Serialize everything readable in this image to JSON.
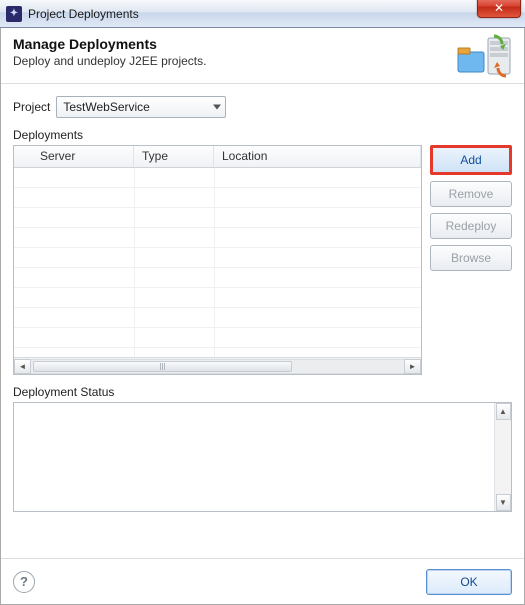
{
  "window": {
    "title": "Project Deployments",
    "close_glyph": "✕"
  },
  "header": {
    "title": "Manage Deployments",
    "subtitle": "Deploy and undeploy J2EE projects."
  },
  "project": {
    "label": "Project",
    "selected": "TestWebService"
  },
  "deployments": {
    "section_label": "Deployments",
    "columns": [
      "Server",
      "Type",
      "Location"
    ],
    "rows": []
  },
  "buttons": {
    "add": "Add",
    "remove": "Remove",
    "redeploy": "Redeploy",
    "browse": "Browse"
  },
  "status": {
    "label": "Deployment Status",
    "text": ""
  },
  "footer": {
    "help_glyph": "?",
    "ok": "OK"
  }
}
